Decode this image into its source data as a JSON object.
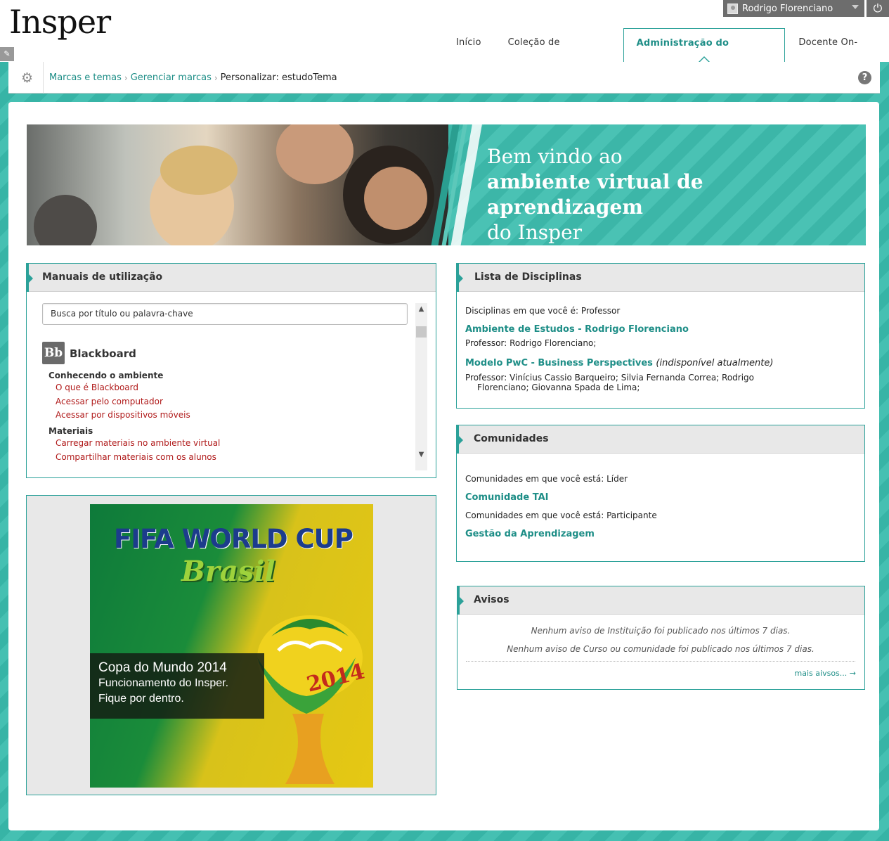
{
  "header": {
    "logo": "Insper",
    "user_name": "Rodrigo Florenciano",
    "tabs": [
      {
        "label": "Início"
      },
      {
        "label": "Coleção de conteúdos"
      },
      {
        "label": "Administração do Sistema"
      },
      {
        "label": "Docente On-Line"
      }
    ]
  },
  "breadcrumb": {
    "items": [
      "Marcas e temas",
      "Gerenciar marcas"
    ],
    "current": "Personalizar: estudoTema"
  },
  "banner": {
    "line1": "Bem vindo ao",
    "line2": "ambiente virtual de aprendizagem",
    "line3": "do Insper"
  },
  "manuais": {
    "title": "Manuais de utilização",
    "search_placeholder": "Busca por título ou palavra-chave",
    "brand_logo": "Bb",
    "brand_title": "Blackboard",
    "sections": [
      {
        "title": "Conhecendo o ambiente",
        "links": [
          "O que é Blackboard",
          "Acessar pelo computador",
          "Acessar por dispositivos móveis"
        ]
      },
      {
        "title": "Materiais",
        "links": [
          "Carregar materiais no ambiente virtual",
          "Compartilhar materiais com os alunos"
        ]
      }
    ]
  },
  "promo": {
    "headline": "FIFA WORLD CUP",
    "sub": "Brasil",
    "year": "2014",
    "caption_1": "Copa do Mundo 2014",
    "caption_2": "Funcionamento do Insper.",
    "caption_3": "Fique por dentro."
  },
  "disciplinas": {
    "title": "Lista de Disciplinas",
    "intro": "Disciplinas em que você é: Professor",
    "courses": [
      {
        "name": "Ambiente de Estudos - Rodrigo Florenciano",
        "note": "",
        "teachers": "Professor: Rodrigo Florenciano;"
      },
      {
        "name": "Modelo PwC - Business Perspectives",
        "note": "(indisponível atualmente)",
        "teachers_1": "Professor: Vinícius Cassio Barqueiro; Silvia Fernanda Correa; Rodrigo",
        "teachers_2": "Florenciano; Giovanna Spada de Lima;"
      }
    ]
  },
  "comunidades": {
    "title": "Comunidades",
    "leader_label": "Comunidades em que você está: Líder",
    "leader_item": "Comunidade TAI",
    "participant_label": "Comunidades em que você está: Participante",
    "participant_item": "Gestão da Aprendizagem"
  },
  "avisos": {
    "title": "Avisos",
    "notice_1": "Nenhum aviso de Instituição foi publicado nos últimos 7 dias.",
    "notice_2": "Nenhum aviso de Curso ou comunidade foi publicado nos últimos 7 dias.",
    "more": "mais aivsos... →"
  },
  "colors": {
    "accent": "#2ba199",
    "link_red": "#b01a1a",
    "teal_bg": "#37b4a6"
  }
}
